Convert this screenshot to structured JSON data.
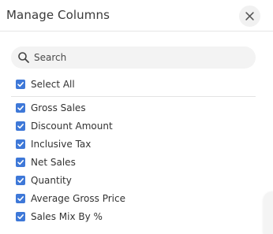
{
  "dialog": {
    "title": "Manage Columns",
    "close_label": "×"
  },
  "search": {
    "placeholder": "Search",
    "value": ""
  },
  "select_all": {
    "label": "Select All",
    "checked": true
  },
  "columns": [
    {
      "label": "Gross Sales",
      "checked": true
    },
    {
      "label": "Discount Amount",
      "checked": true
    },
    {
      "label": "Inclusive Tax",
      "checked": true
    },
    {
      "label": "Net Sales",
      "checked": true
    },
    {
      "label": "Quantity",
      "checked": true
    },
    {
      "label": "Average Gross Price",
      "checked": true
    },
    {
      "label": "Sales Mix By %",
      "checked": true
    }
  ],
  "colors": {
    "checkbox_accent": "#3e78d8",
    "search_bg": "#f3f3f3",
    "close_bg": "#f1f1f1"
  }
}
